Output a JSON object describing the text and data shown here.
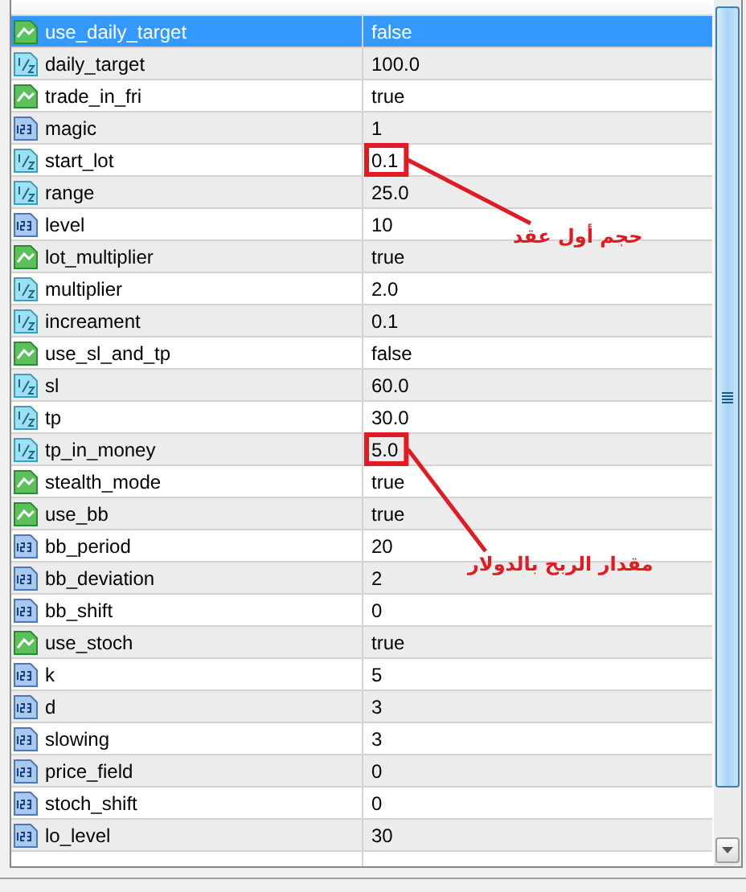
{
  "table": {
    "rows": [
      {
        "kind": "bool",
        "name": "use_daily_target",
        "value": "false",
        "selected": true
      },
      {
        "kind": "double",
        "name": "daily_target",
        "value": "100.0",
        "selected": false
      },
      {
        "kind": "bool",
        "name": "trade_in_fri",
        "value": "true",
        "selected": false
      },
      {
        "kind": "int",
        "name": "magic",
        "value": "1",
        "selected": false
      },
      {
        "kind": "double",
        "name": "start_lot",
        "value": "0.1",
        "selected": false,
        "annotation": "حجم أول عقد"
      },
      {
        "kind": "double",
        "name": "range",
        "value": "25.0",
        "selected": false
      },
      {
        "kind": "int",
        "name": "level",
        "value": "10",
        "selected": false
      },
      {
        "kind": "bool",
        "name": "lot_multiplier",
        "value": "true",
        "selected": false
      },
      {
        "kind": "double",
        "name": "multiplier",
        "value": "2.0",
        "selected": false
      },
      {
        "kind": "double",
        "name": "increament",
        "value": "0.1",
        "selected": false
      },
      {
        "kind": "bool",
        "name": "use_sl_and_tp",
        "value": "false",
        "selected": false
      },
      {
        "kind": "double",
        "name": "sl",
        "value": "60.0",
        "selected": false
      },
      {
        "kind": "double",
        "name": "tp",
        "value": "30.0",
        "selected": false
      },
      {
        "kind": "double",
        "name": "tp_in_money",
        "value": "5.0",
        "selected": false,
        "annotation": "مقدار الربح بالدولار"
      },
      {
        "kind": "bool",
        "name": "stealth_mode",
        "value": "true",
        "selected": false
      },
      {
        "kind": "bool",
        "name": "use_bb",
        "value": "true",
        "selected": false
      },
      {
        "kind": "int",
        "name": "bb_period",
        "value": "20",
        "selected": false
      },
      {
        "kind": "int",
        "name": "bb_deviation",
        "value": "2",
        "selected": false
      },
      {
        "kind": "int",
        "name": "bb_shift",
        "value": "0",
        "selected": false
      },
      {
        "kind": "bool",
        "name": "use_stoch",
        "value": "true",
        "selected": false
      },
      {
        "kind": "int",
        "name": "k",
        "value": "5",
        "selected": false
      },
      {
        "kind": "int",
        "name": "d",
        "value": "3",
        "selected": false
      },
      {
        "kind": "int",
        "name": "slowing",
        "value": "3",
        "selected": false
      },
      {
        "kind": "int",
        "name": "price_field",
        "value": "0",
        "selected": false
      },
      {
        "kind": "int",
        "name": "stoch_shift",
        "value": "0",
        "selected": false
      },
      {
        "kind": "int",
        "name": "lo_level",
        "value": "30",
        "selected": false
      }
    ]
  }
}
